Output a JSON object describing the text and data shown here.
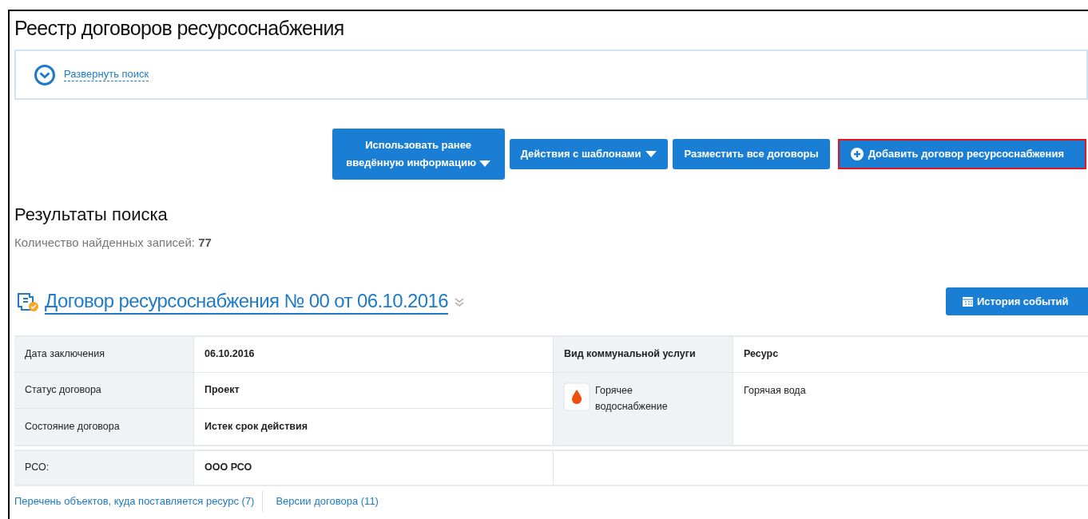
{
  "page_title": "Реестр договоров ресурсоснабжения",
  "search_toggle": {
    "label": "Развернуть поиск",
    "expanded": false
  },
  "actions": [
    {
      "label": "Использовать ранее введённую информацию",
      "kind": "dropdown",
      "highlighted": false
    },
    {
      "label": "Действия с шаблонами",
      "kind": "dropdown",
      "highlighted": false
    },
    {
      "label": "Разместить все договоры",
      "kind": "plain",
      "highlighted": false
    },
    {
      "label": "Добавить договор ресурсоснабжения",
      "kind": "add",
      "highlighted": true
    }
  ],
  "results": {
    "title": "Результаты поиска",
    "count_label": "Количество найденных записей:",
    "count": "77"
  },
  "contract": {
    "title": "Договор ресурсоснабжения № 00 от 06.10.2016",
    "history_button": "История событий",
    "details": [
      {
        "label": "Дата заключения",
        "value": "06.10.2016"
      },
      {
        "label": "Статус договора",
        "value": "Проект"
      },
      {
        "label": "Состояние договора",
        "value": "Истек срок действия"
      }
    ],
    "service_header": "Вид коммунальной услуги",
    "resource_header": "Ресурс",
    "service": "Горячее водоснабжение",
    "resource": "Горячая вода",
    "rso": {
      "label": "РСО:",
      "value": "ООО РСО"
    },
    "links": [
      "Перечень объектов, куда поставляется ресурс (7)",
      "Версии договора (11)"
    ]
  }
}
